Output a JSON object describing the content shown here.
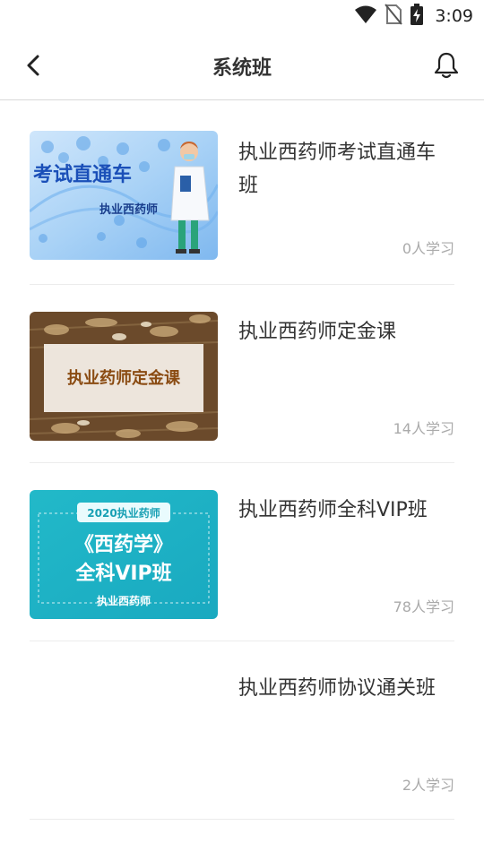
{
  "status_bar": {
    "time": "3:09"
  },
  "header": {
    "title": "系统班"
  },
  "courses": [
    {
      "title": "执业西药师考试直通车班",
      "learners": "0人学习",
      "thumb": {
        "headline": "考试直通车",
        "subline": "执业西药师"
      }
    },
    {
      "title": "执业西药师定金课",
      "learners": "14人学习",
      "thumb": {
        "headline": "执业药师定金课"
      }
    },
    {
      "title": "执业西药师全科VIP班",
      "learners": "78人学习",
      "thumb": {
        "tag": "2020执业药师",
        "line1": "《西药学》",
        "line2": "全科VIP班",
        "line3": "执业西药师"
      }
    },
    {
      "title": "执业西药师协议通关班",
      "learners": "2人学习"
    }
  ],
  "colors": {
    "accent_blue": "#1a4fb8",
    "teal": "#1fb8c6",
    "brown_text": "#8a4b12"
  }
}
